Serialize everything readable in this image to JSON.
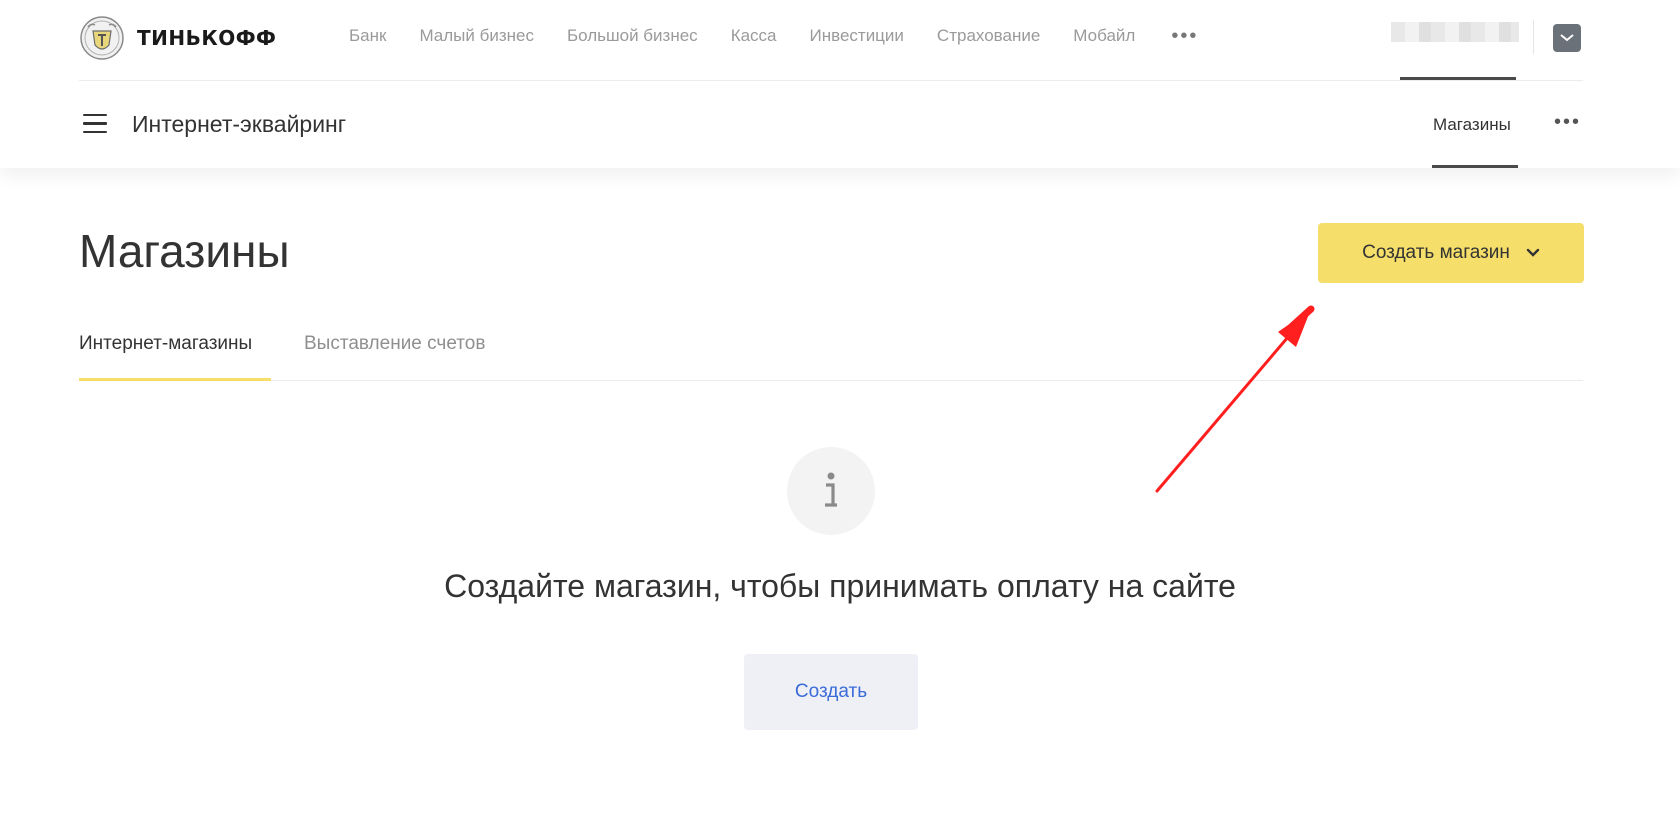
{
  "header": {
    "brand": "ТИНЬКОФФ",
    "nav": [
      "Банк",
      "Малый бизнес",
      "Большой бизнес",
      "Касса",
      "Инвестиции",
      "Страхование",
      "Мобайл"
    ],
    "nav_more": "•••"
  },
  "subnav": {
    "title": "Интернет-эквайринг",
    "link": "Магазины",
    "more": "•••"
  },
  "main": {
    "title": "Магазины",
    "create_store_label": "Создать магазин",
    "tabs": [
      "Интернет-магазины",
      "Выставление счетов"
    ],
    "empty_message": "Создайте магазин, чтобы принимать оплату на сайте",
    "create_label": "Создать"
  },
  "colors": {
    "accent_yellow": "#f5df6a",
    "link_blue": "#3b6bd9",
    "annotation_red": "#ff1f1f"
  },
  "icons": [
    "tinkoff-emblem-icon",
    "menu-icon",
    "mail-icon",
    "chevron-down-icon",
    "info-icon",
    "annotation-arrow-icon"
  ]
}
